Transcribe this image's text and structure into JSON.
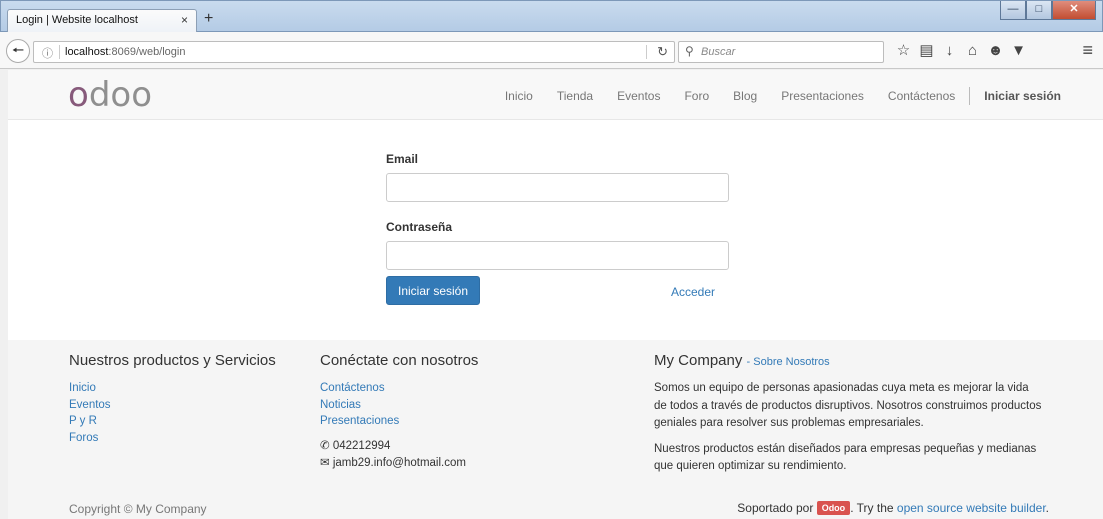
{
  "browser": {
    "tab_title": "Login | Website localhost",
    "tab_close": "×",
    "new_tab": "+",
    "url_host": "localhost",
    "url_rest": ":8069/web/login",
    "search_placeholder": "Buscar",
    "window_buttons": [
      "minimize",
      "maximize",
      "close"
    ],
    "toolbar_icons": [
      "bookmark-star-icon",
      "reading-list-icon",
      "download-icon",
      "home-icon",
      "chat-icon",
      "pocket-icon"
    ]
  },
  "site": {
    "logo": {
      "first": "o",
      "rest": "doo"
    },
    "nav": [
      "Inicio",
      "Tienda",
      "Eventos",
      "Foro",
      "Blog",
      "Presentaciones",
      "Contáctenos"
    ],
    "signin": "Iniciar sesión"
  },
  "login": {
    "email_label": "Email",
    "email_value": "",
    "password_label": "Contraseña",
    "password_value": "",
    "submit": "Iniciar sesión",
    "alt_link": "Acceder"
  },
  "footer": {
    "col1": {
      "title": "Nuestros productos y Servicios",
      "links": [
        "Inicio",
        "Eventos",
        "P y R",
        "Foros"
      ]
    },
    "col2": {
      "title": "Conéctate con nosotros",
      "links": [
        "Contáctenos",
        "Noticias",
        "Presentaciones"
      ],
      "phone": "042212994",
      "email": "jamb29.info@hotmail.com"
    },
    "col3": {
      "title": "My Company",
      "about": "- Sobre Nosotros",
      "p1": "Somos un equipo de personas apasionadas cuya meta es mejorar la vida de todos a través de productos disruptivos. Nosotros construimos productos geniales para resolver sus problemas empresariales.",
      "p2": "Nuestros productos están diseñados para empresas pequeñas y medianas que quieren optimizar su rendimiento."
    },
    "copyright": "Copyright © My Company",
    "powered_prefix": "Soportado por",
    "badge": "Odoo",
    "powered_mid": ". Try the",
    "builder_link": "open source website builder",
    "powered_end": "."
  },
  "colors": {
    "brand": "#875a7b",
    "primary": "#337ab7",
    "badge": "#d9534f"
  }
}
